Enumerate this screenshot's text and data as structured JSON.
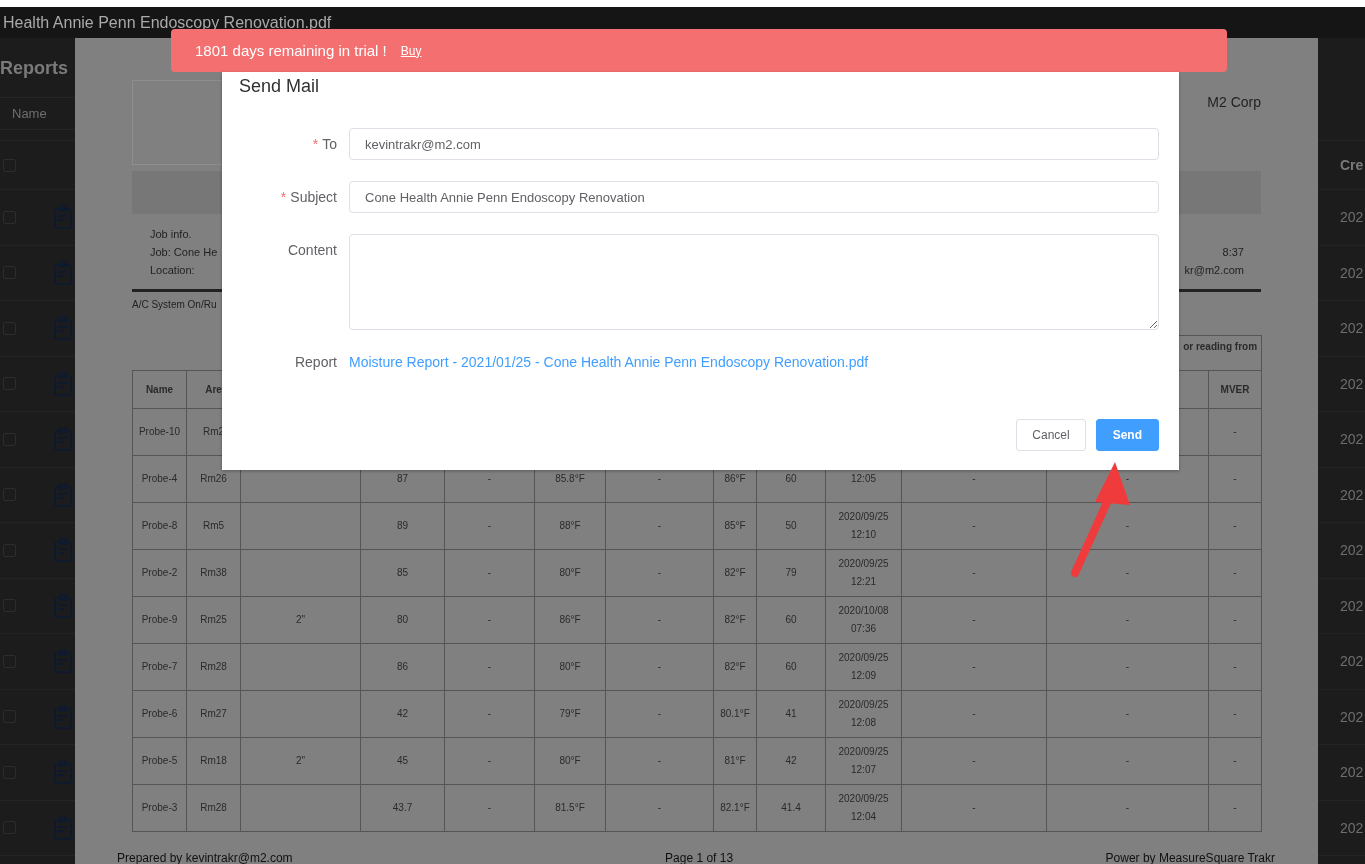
{
  "window": {
    "title": "Health Annie Penn Endoscopy Renovation.pdf"
  },
  "trial_banner": {
    "message": "1801 days remaining in trial !",
    "link": "Buy"
  },
  "reports_panel": {
    "title": "Reports",
    "name_header": "Name",
    "header_checkbox": {
      "checked": false
    },
    "rows": [
      {
        "checked": false
      },
      {
        "checked": false
      },
      {
        "checked": false
      },
      {
        "checked": false
      },
      {
        "checked": false
      },
      {
        "checked": false
      },
      {
        "checked": false
      },
      {
        "checked": false
      },
      {
        "checked": false
      },
      {
        "checked": false
      },
      {
        "checked": false
      },
      {
        "checked": false
      }
    ]
  },
  "right_column": {
    "header": "Cre",
    "cells": [
      "202",
      "202",
      "202",
      "202",
      "202",
      "202",
      "202",
      "202",
      "202",
      "202",
      "202",
      "202"
    ]
  },
  "document": {
    "company": "M2 Corp",
    "job_info": [
      "Job info.",
      "Job: Cone He",
      "Location:"
    ],
    "job_info_right": [
      "8:37",
      "kr@m2.com"
    ],
    "section_note": "A/C System On/Ru",
    "table": {
      "group_header": "or reading from",
      "columns": [
        "Name",
        "Are",
        null,
        null,
        null,
        null,
        null,
        null,
        null,
        null,
        null,
        null,
        "MVER"
      ],
      "rows": [
        [
          "Probe-10",
          "Rm2",
          null,
          null,
          null,
          null,
          null,
          null,
          null,
          null,
          null,
          null,
          "-"
        ],
        [
          "Probe-4",
          "Rm26",
          null,
          "87",
          "-",
          "85.8°F",
          "-",
          "86°F",
          "60",
          "12:05",
          "-",
          "-",
          "-"
        ],
        [
          "Probe-8",
          "Rm5",
          null,
          "89",
          "-",
          "88°F",
          "-",
          "85°F",
          "50",
          "2020/09/25\n12:10",
          "-",
          "-",
          "-"
        ],
        [
          "Probe-2",
          "Rm38",
          null,
          "85",
          "-",
          "80°F",
          "-",
          "82°F",
          "79",
          "2020/09/25\n12:21",
          "-",
          "-",
          "-"
        ],
        [
          "Probe-9",
          "Rm25",
          "2\"",
          "80",
          "-",
          "86°F",
          "-",
          "82°F",
          "60",
          "2020/10/08\n07:36",
          "-",
          "-",
          "-"
        ],
        [
          "Probe-7",
          "Rm28",
          null,
          "86",
          "-",
          "80°F",
          "-",
          "82°F",
          "60",
          "2020/09/25\n12:09",
          "-",
          "-",
          "-"
        ],
        [
          "Probe-6",
          "Rm27",
          null,
          "42",
          "-",
          "79°F",
          "-",
          "80.1°F",
          "41",
          "2020/09/25\n12:08",
          "-",
          "-",
          "-"
        ],
        [
          "Probe-5",
          "Rm18",
          "2\"",
          "45",
          "-",
          "80°F",
          "-",
          "81°F",
          "42",
          "2020/09/25\n12:07",
          "-",
          "-",
          "-"
        ],
        [
          "Probe-3",
          "Rm28",
          null,
          "43.7",
          "-",
          "81.5°F",
          "-",
          "82.1°F",
          "41.4",
          "2020/09/25\n12:04",
          "-",
          "-",
          "-"
        ]
      ]
    },
    "footer": {
      "prepared_by": "Prepared by kevintrakr@m2.com",
      "page": "Page 1 of 13",
      "powered_by": "Power by MeasureSquare Trakr"
    }
  },
  "dialog": {
    "title": "Send Mail",
    "fields": [
      {
        "label": "To",
        "required_mark": "*",
        "kind": "input",
        "value": "kevintrakr@m2.com"
      },
      {
        "label": "Subject",
        "required_mark": "*",
        "kind": "input",
        "value": "Cone Health Annie Penn Endoscopy Renovation"
      },
      {
        "label": "Content",
        "kind": "textarea"
      }
    ],
    "report": {
      "label": "Report",
      "link": "Moisture Report - 2021/01/25 - Cone Health Annie Penn Endoscopy Renovation.pdf"
    },
    "buttons": [
      {
        "label": "Cancel",
        "kind": "default"
      },
      {
        "label": "Send",
        "kind": "primary"
      }
    ]
  }
}
